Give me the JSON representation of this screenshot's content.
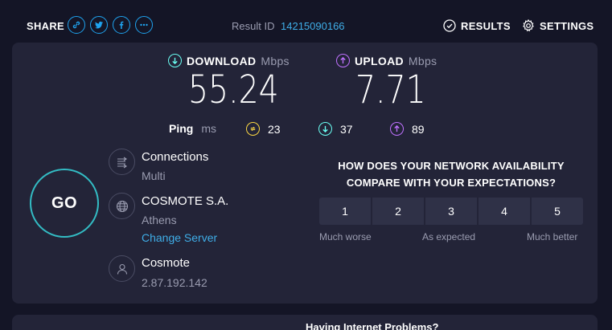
{
  "header": {
    "share_label": "SHARE",
    "share_icons": [
      "link-icon",
      "twitter-icon",
      "facebook-icon",
      "more-icon"
    ],
    "result_label": "Result ID",
    "result_id": "14215090166",
    "results_label": "RESULTS",
    "settings_label": "SETTINGS"
  },
  "download": {
    "label": "DOWNLOAD",
    "unit": "Mbps",
    "value": "55.24",
    "color": "#6afff3"
  },
  "upload": {
    "label": "UPLOAD",
    "unit": "Mbps",
    "value": "7.71",
    "color": "#bf71ff"
  },
  "ping": {
    "label": "Ping",
    "unit": "ms",
    "idle": "23",
    "download": "37",
    "upload": "89",
    "idle_color": "#fbd743"
  },
  "go_label": "GO",
  "connection": {
    "title": "Connections",
    "value": "Multi",
    "host": "COSMOTE S.A.",
    "location": "Athens",
    "change_server": "Change Server",
    "isp": "Cosmote",
    "ip": "2.87.192.142"
  },
  "survey": {
    "question": "HOW DOES YOUR NETWORK AVAILABILITY COMPARE WITH YOUR EXPECTATIONS?",
    "options": [
      "1",
      "2",
      "3",
      "4",
      "5"
    ],
    "low_label": "Much worse",
    "mid_label": "As expected",
    "high_label": "Much better"
  },
  "footer": {
    "help_title": "Having Internet Problems?"
  }
}
